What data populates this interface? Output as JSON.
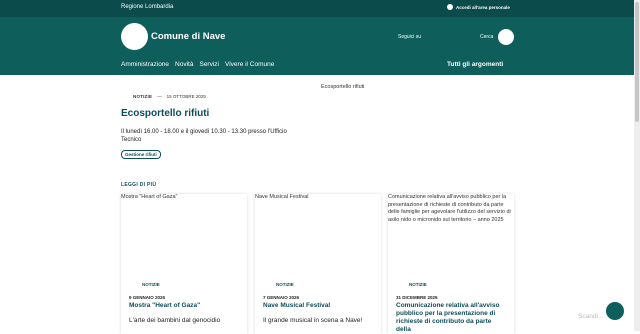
{
  "topbar": {
    "region": "Regione Lombardia",
    "login": "Accedi all'area personale"
  },
  "header": {
    "title": "Comune di Nave",
    "follow": "Seguici su",
    "search": "Cerca"
  },
  "nav": {
    "items": [
      "Amministrazione",
      "Novità",
      "Servizi",
      "Vivere il Comune"
    ],
    "all_topics": "Tutti gli argomenti"
  },
  "article": {
    "category": "NOTIZIE",
    "separator": "—",
    "date": "15 OTTOBRE 2025",
    "title": "Ecosportello rifiuti",
    "description": "Il lunedì 16.00 - 18.00 e il giovedì 10.30 - 13.30 presso l'Ufficio Tecnico",
    "tag": "Gestione rifiuti",
    "image_alt": "Ecosportello rifiuti"
  },
  "read_more": "LEGGI DI PIÙ",
  "cards": [
    {
      "alt": "Mostra \"Heart of Gaza\"",
      "category": "NOTIZIE",
      "date": "9 GENNAIO 2026",
      "title": "Mostra \"Heart of Gaza\"",
      "desc": "L'arte dei bambini dal genocidio"
    },
    {
      "alt": "Nave Musical Festival",
      "category": "NOTIZIE",
      "date": "7 GENNAIO 2026",
      "title": "Nave Musical Festival",
      "desc": "Il grande musical in scena a Nave!"
    },
    {
      "alt": "Comunicazione relativa all'avviso pubblico per la presentazione di richieste di contributo da parte delle famiglie per agevolare l'utilizzo del servizio di asilo nido o micronido sul territorio – anno 2025",
      "category": "NOTIZIE",
      "date": "31 DICEMBRE 2025",
      "title": "Comunicazione relativa all'avviso pubblico per la presentazione di richieste di contributo da parte della",
      "desc": ""
    }
  ],
  "watermark": "Scandi...",
  "colors": {
    "topbar": "#0b4b4b",
    "header": "#0e5e5c",
    "accent": "#0e4d5a"
  }
}
